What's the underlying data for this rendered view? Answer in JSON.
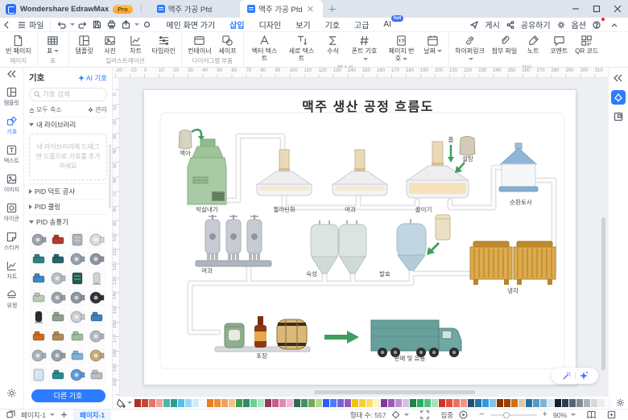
{
  "window": {
    "brand": "Wondershare EdrawMax",
    "pro": "Pro",
    "tabs": [
      {
        "label": "맥주 가공 Pfd"
      },
      {
        "label": "맥주 가공 Pfd"
      }
    ]
  },
  "menubar": {
    "file": "파일",
    "menus": [
      {
        "label": "메인 화면 가기"
      },
      {
        "label": "삽입"
      },
      {
        "label": "디자인"
      },
      {
        "label": "보기"
      },
      {
        "label": "기호"
      },
      {
        "label": "고급"
      },
      {
        "label": "AI",
        "badge": "hot"
      }
    ],
    "publish": "게시",
    "share": "공유하기",
    "options": "옵션"
  },
  "ribbon": {
    "groups": [
      {
        "caption": "페이지",
        "items": [
          {
            "label": "빈 페이지"
          }
        ]
      },
      {
        "caption": "표",
        "items": [
          {
            "label": "표"
          }
        ]
      },
      {
        "caption": "일러스트레이션",
        "items": [
          {
            "label": "템플릿"
          },
          {
            "label": "사진"
          },
          {
            "label": "차트"
          },
          {
            "label": "타임라인"
          }
        ]
      },
      {
        "caption": "다이어그램 부품",
        "items": [
          {
            "label": "컨테이너"
          },
          {
            "label": "셰이프"
          }
        ]
      },
      {
        "caption": "텍스트",
        "items": [
          {
            "label": "벡터 텍스트"
          },
          {
            "label": "세로 텍스트"
          },
          {
            "label": "수식"
          },
          {
            "label": "폰트 기호"
          },
          {
            "label": "페이지 번호"
          },
          {
            "label": "날짜"
          }
        ]
      },
      {
        "caption": "기타",
        "items": [
          {
            "label": "하이퍼링크"
          },
          {
            "label": "첨부 파일"
          },
          {
            "label": "노트"
          },
          {
            "label": "코멘트"
          },
          {
            "label": "QR 코드"
          }
        ]
      }
    ]
  },
  "left_rail": {
    "items": [
      {
        "label": "템플릿"
      },
      {
        "label": "기호"
      },
      {
        "label": "텍스트"
      },
      {
        "label": "이미지"
      },
      {
        "label": "아이콘"
      },
      {
        "label": "스티커"
      },
      {
        "label": "차트"
      },
      {
        "label": "위젯"
      }
    ]
  },
  "symbol_panel": {
    "title": "기호",
    "ai_link": "AI 기호",
    "search_placeholder": "기호 검색",
    "collapse_all": "모두 축소",
    "manage": "관리",
    "sections": [
      {
        "label": "내 라이브러리"
      },
      {
        "label": "PID 덕트 공사"
      },
      {
        "label": "PID 쿨링"
      },
      {
        "label": "PID 송풍기"
      }
    ],
    "library_hint": "내 라이브러리에 드래그 앤 드롭으로 기호를 추가하세요",
    "more_button": "다른 기호",
    "grid": [
      {
        "t": "fan",
        "c": "#9aa3ac"
      },
      {
        "t": "unit",
        "c": "#b03a2e"
      },
      {
        "t": "box",
        "c": "#aab3bb"
      },
      {
        "t": "fan",
        "c": "#d8dde1"
      },
      {
        "t": "unit",
        "c": "#2e7f85"
      },
      {
        "t": "unit",
        "c": "#27646a"
      },
      {
        "t": "fan",
        "c": "#98a1aa"
      },
      {
        "t": "fan",
        "c": "#8d969f"
      },
      {
        "t": "unit",
        "c": "#3f87c0"
      },
      {
        "t": "fan",
        "c": "#b8c0c7"
      },
      {
        "t": "box",
        "c": "#1f5c50"
      },
      {
        "t": "tank",
        "c": "#cfd8cf"
      },
      {
        "t": "unit",
        "c": "#b9ccb3"
      },
      {
        "t": "fan",
        "c": "#9aa3ac"
      },
      {
        "t": "fan",
        "c": "#8d969f"
      },
      {
        "t": "fan",
        "c": "#2f3337"
      },
      {
        "t": "tank",
        "c": "#2b2b2b"
      },
      {
        "t": "unit",
        "c": "#8fa08f"
      },
      {
        "t": "fan",
        "c": "#c8cfd4"
      },
      {
        "t": "unit",
        "c": "#3f7fbf"
      },
      {
        "t": "unit",
        "c": "#d2691e"
      },
      {
        "t": "unit",
        "c": "#b08a5a"
      },
      {
        "t": "unit",
        "c": "#9fbf9f"
      },
      {
        "t": "fan",
        "c": "#b3bac0"
      },
      {
        "t": "fan",
        "c": "#aab3bb"
      },
      {
        "t": "fan",
        "c": "#98a1aa"
      },
      {
        "t": "unit",
        "c": "#7fb2d9"
      },
      {
        "t": "fan",
        "c": "#c9a878"
      },
      {
        "t": "box",
        "c": "#cfe4ee"
      },
      {
        "t": "unit",
        "c": "#2e8b8b"
      },
      {
        "t": "fan",
        "c": "#5b9bd5"
      },
      {
        "t": "unit",
        "c": "#b8bfc6"
      }
    ]
  },
  "rulers": {
    "h": {
      "start": -20,
      "end": 310,
      "step": 10
    },
    "v": {
      "start": 0,
      "end": 200,
      "step": 10
    }
  },
  "diagram": {
    "title": "맥주 생산 공정 흐름도",
    "nodes": [
      {
        "label": "맥아"
      },
      {
        "label": "박살내기"
      },
      {
        "label": "젤라틴화"
      },
      {
        "label": "여과"
      },
      {
        "label": "홉"
      },
      {
        "label": "설탕"
      },
      {
        "label": "끓이기"
      },
      {
        "label": "순환토사"
      },
      {
        "label": "여과"
      },
      {
        "label": "숙성"
      },
      {
        "label": "발효"
      },
      {
        "label": "냉각"
      },
      {
        "label": "포장"
      },
      {
        "label": "판매 및 유통"
      }
    ]
  },
  "palette": {
    "colors": [
      "#a93226",
      "#cb4335",
      "#e6746a",
      "#f0a29a",
      "#45b8ac",
      "#2e9e93",
      "#57c1e8",
      "#9ad6f0",
      "#cdeef8",
      "#f6f8f9",
      "#e67e22",
      "#eb8f3e",
      "#f0a35c",
      "#f5c08e",
      "#3f9e4d",
      "#2e8b6e",
      "#6fcf97",
      "#a8e6c3",
      "#8e3b5f",
      "#c85a8e",
      "#e08ab2",
      "#f2b8d2",
      "#2d6a4f",
      "#40916c",
      "#74a85e",
      "#b5d98a",
      "#2e5bff",
      "#4d7cfe",
      "#7b61d6",
      "#9b59b6",
      "#f1c40f",
      "#f4d03f",
      "#f7dc6f",
      "#fdf2c4",
      "#7d3c98",
      "#9b59b6",
      "#bb8fce",
      "#d7bde2",
      "#1e8449",
      "#27ae60",
      "#52be80",
      "#a9dfbf",
      "#c0392b",
      "#e74c3c",
      "#ec7063",
      "#f1948a",
      "#1a5276",
      "#2874a6",
      "#3498db",
      "#85c1e9",
      "#873600",
      "#a04000",
      "#ca6f1e",
      "#e0c9a6",
      "#2471a3",
      "#5499c7",
      "#7fb3d5",
      "#d4e6f1",
      "#17202a",
      "#2c3e50",
      "#566573",
      "#808b96",
      "#abb2b9",
      "#d5d8dc",
      "#eaecee",
      "#f8f9f9"
    ]
  },
  "statusbar": {
    "page_dropdown": "페이지-1",
    "page_tab": "페이지-1",
    "shape_count": "형태 수: 557",
    "focus": "집중",
    "zoom": "90%"
  }
}
